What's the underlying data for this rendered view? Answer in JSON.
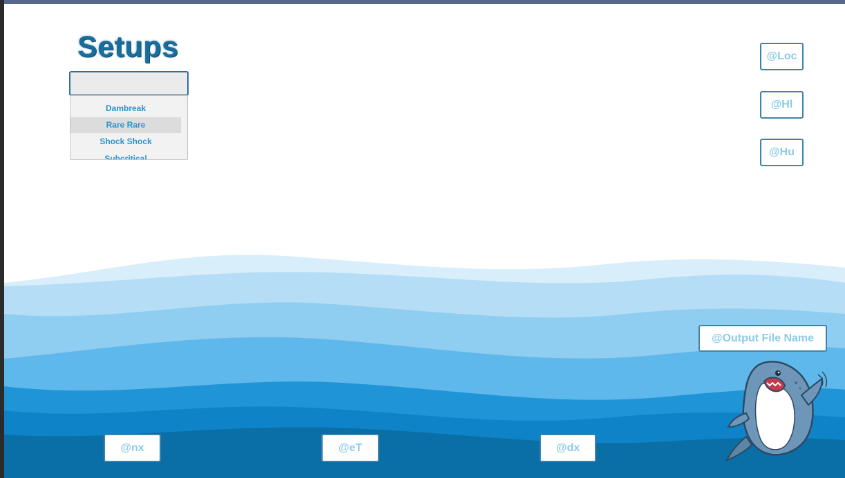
{
  "setups": {
    "title": "Setups",
    "combo_value": "",
    "options": [
      "Dambreak",
      "Rare Rare",
      "Shock Shock",
      "Subcritical"
    ],
    "selected_option": "Rare Rare"
  },
  "buttons": {
    "loc": "@Loc",
    "hl": "@Hl",
    "hu": "@Hu",
    "output_file_name": "@Output File Name",
    "nx": "@nx",
    "et": "@eT",
    "dx": "@dx"
  },
  "colors": {
    "title": "#1a6d9a",
    "button_border": "#3f84a8",
    "button_text": "#8ccbe6",
    "option_text": "#2a93cf",
    "wave_light": "#b5def6",
    "wave_mid": "#5fb8ec",
    "wave_dark": "#0a74b5"
  },
  "icons": {
    "mascot": "shark-mascot-icon"
  }
}
